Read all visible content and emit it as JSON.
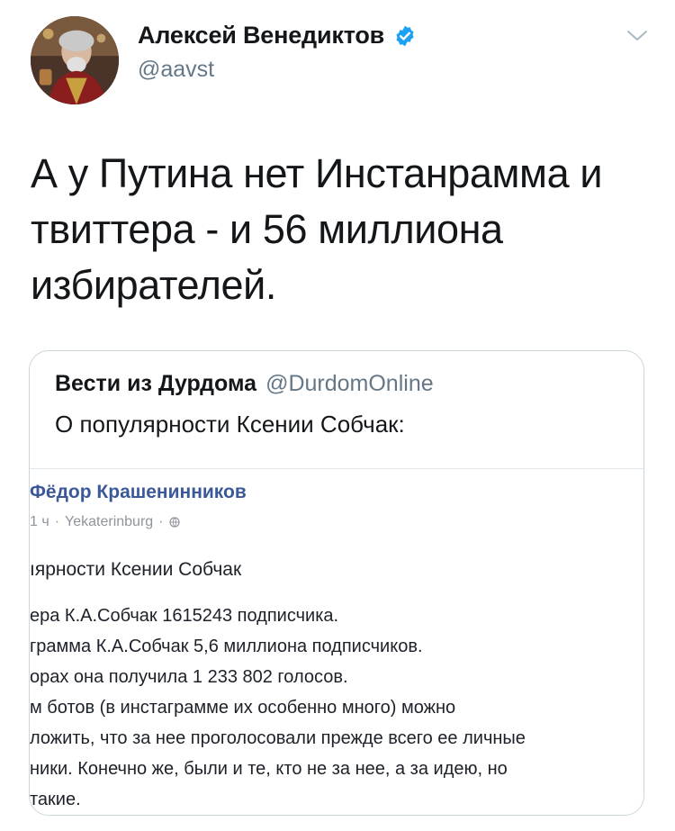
{
  "tweet": {
    "display_name": "Алексей Венедиктов",
    "handle": "@aavst",
    "text": "А у Путина нет Инстанрамма и\nтвиттера - и 56 миллиона\nизбирателей."
  },
  "quote": {
    "name": "Вести из Дурдома",
    "handle": "@DurdomOnline",
    "text": "О популярности Ксении Собчак:"
  },
  "embedded_post": {
    "author": "Фёдор Крашенинников",
    "time": "1 ч",
    "location": "Yekaterinburg",
    "separator": "·",
    "title": "ıярности Ксении Собчак",
    "lines": [
      "ера К.А.Собчак 1615243 подписчика.",
      "грамма К.А.Собчак 5,6 миллиона подписчиков.",
      "орах она получила 1 233 802 голосов.",
      "м ботов (в инстаграмме их особенно много) можно",
      "ложить, что за нее проголосовали прежде всего ее личные",
      "ники. Конечно же, были и те, кто не за нее, а за идею, но",
      "такие."
    ]
  },
  "icons": {
    "verified": "verified-badge-icon",
    "chevron": "chevron-down-icon",
    "globe": "globe-icon"
  },
  "colors": {
    "verified_blue": "#1da1f2",
    "facebook_blue": "#3b5998",
    "secondary_text": "#657786"
  }
}
